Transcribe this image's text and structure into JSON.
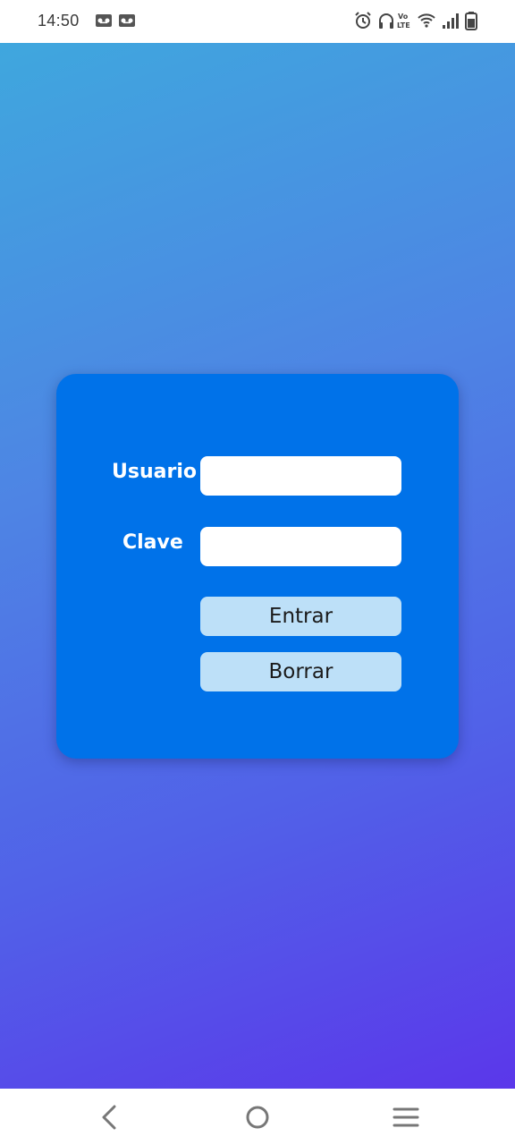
{
  "status_bar": {
    "time": "14:50",
    "notification_icons": [
      "voicemail-icon",
      "voicemail-icon"
    ],
    "system_icons": [
      "alarm-icon",
      "headphones-icon",
      "volte-icon",
      "wifi-icon",
      "signal-icon",
      "battery-icon"
    ],
    "volte_text": "Vo)) LTE"
  },
  "login": {
    "username_label": "Usuario",
    "username_value": "",
    "password_label": "Clave",
    "password_value": "",
    "submit_label": "Entrar",
    "clear_label": "Borrar"
  },
  "nav_bar": {
    "icons": [
      "back-icon",
      "home-icon",
      "menu-icon"
    ]
  },
  "colors": {
    "background_gradient_start": "#3fa7de",
    "background_gradient_end": "#5b37ea",
    "card": "#0072e9",
    "button": "#bde0f8"
  }
}
